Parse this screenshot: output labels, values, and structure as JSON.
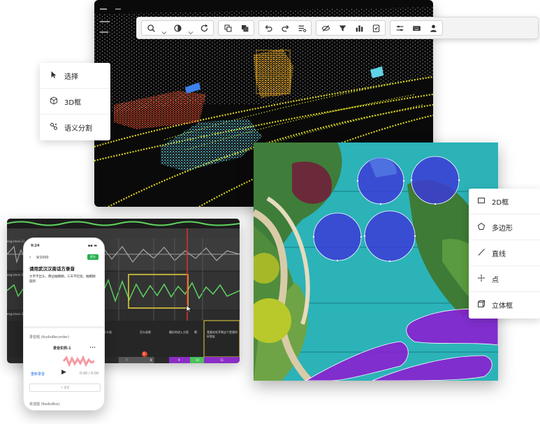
{
  "left_menu": {
    "items": [
      {
        "label": "选择",
        "icon": "cursor-icon"
      },
      {
        "label": "3D框",
        "icon": "cube-icon"
      },
      {
        "label": "语义分割",
        "icon": "segment-icon"
      }
    ]
  },
  "right_menu": {
    "items": [
      {
        "label": "2D框",
        "icon": "rectangle-icon"
      },
      {
        "label": "多边形",
        "icon": "polygon-icon"
      },
      {
        "label": "直线",
        "icon": "line-icon"
      },
      {
        "label": "点",
        "icon": "point-icon"
      },
      {
        "label": "立体框",
        "icon": "cuboid-icon"
      }
    ]
  },
  "toolbar": {
    "icons": [
      "search-icon",
      "contrast-icon",
      "refresh-icon",
      "copy-icon",
      "paste-icon",
      "undo-icon",
      "redo-icon",
      "list-icon",
      "hide-icon",
      "filter-icon",
      "chart-icon",
      "check-icon",
      "settings-icon",
      "keyboard-icon",
      "user-icon"
    ]
  },
  "phone": {
    "time": "9:24",
    "progress": "9/1000",
    "submit": "提交",
    "title": "请用武汉汉南话方录音",
    "instruction": "大字不出头，两边抽模糊，三天不吃饭，抽模糊圆到",
    "recorder_label": "录音题 (AudioRecorder)",
    "example_label": "录音实例-1",
    "example_more": "•••",
    "rerecord": "重新录音",
    "duration": "0:00 / 0:00",
    "add_label": "+ 录音",
    "single_choice": "单选题 (RadioBox)"
  },
  "audio": {
    "track_labels": [
      "eng-(men-2)",
      "eng-(men-2)",
      "eng-(men-2)"
    ],
    "segment_texts": [
      "什么啥",
      "怎么说呢",
      "最好的进入方案",
      "嗯",
      "我喜欢吃苹果这个是我的好朋友"
    ],
    "segment_numbers": [
      "7",
      "8",
      "9",
      "10",
      "11"
    ],
    "badge": "8"
  }
}
